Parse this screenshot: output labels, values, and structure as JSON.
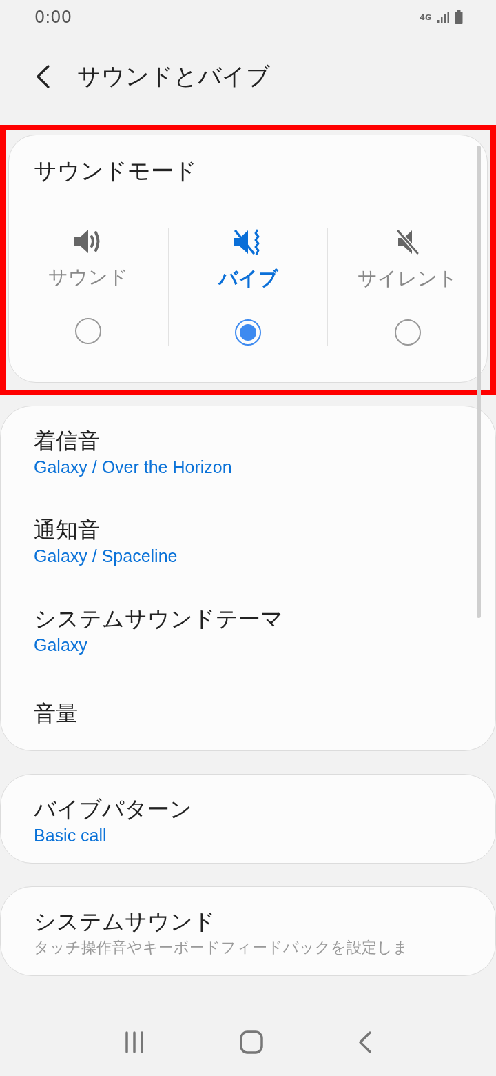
{
  "status_bar": {
    "time": "0:00",
    "network": "4G"
  },
  "header": {
    "title": "サウンドとバイブ"
  },
  "sound_mode": {
    "title": "サウンドモード",
    "highlighted": true,
    "options": [
      {
        "kind": "sound",
        "label": "サウンド",
        "selected": false
      },
      {
        "kind": "vibrate",
        "label": "バイブ",
        "selected": true
      },
      {
        "kind": "silent",
        "label": "サイレント",
        "selected": false
      }
    ]
  },
  "groups": [
    {
      "items": [
        {
          "title": "着信音",
          "subtitle": "Galaxy / Over the Horizon"
        },
        {
          "title": "通知音",
          "subtitle": "Galaxy / Spaceline"
        },
        {
          "title": "システムサウンドテーマ",
          "subtitle": "Galaxy"
        },
        {
          "title": "音量"
        }
      ]
    },
    {
      "items": [
        {
          "title": "バイブパターン",
          "subtitle": "Basic call"
        }
      ]
    },
    {
      "items": [
        {
          "title": "システムサウンド",
          "description": "タッチ操作音やキーボードフィードバックを設定しま"
        }
      ]
    }
  ]
}
